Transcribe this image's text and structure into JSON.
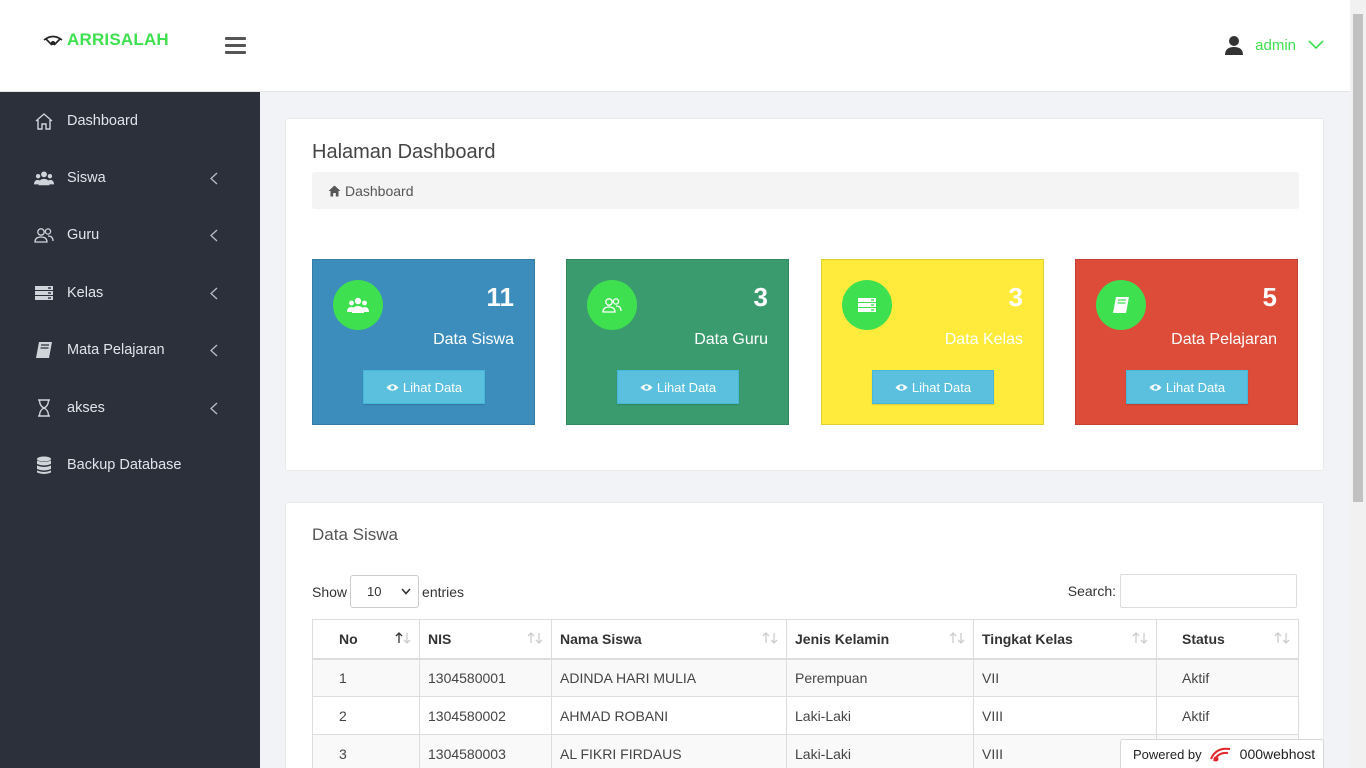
{
  "brand": {
    "name": "ARRISALAH"
  },
  "header": {
    "username": "admin"
  },
  "sidebar": {
    "items": [
      {
        "label": "Dashboard",
        "icon": "home-icon"
      },
      {
        "label": "Siswa",
        "icon": "users-icon"
      },
      {
        "label": "Guru",
        "icon": "user-group-icon"
      },
      {
        "label": "Kelas",
        "icon": "server-icon"
      },
      {
        "label": "Mata Pelajaran",
        "icon": "book-icon"
      },
      {
        "label": "akses",
        "icon": "hourglass-icon"
      },
      {
        "label": "Backup Database",
        "icon": "database-icon"
      }
    ]
  },
  "page": {
    "title": "Halaman Dashboard",
    "breadcrumb": "Dashboard"
  },
  "cards": [
    {
      "count": "11",
      "label": "Data Siswa",
      "button": "Lihat Data",
      "color": "#3c8dbc"
    },
    {
      "count": "3",
      "label": "Data Guru",
      "button": "Lihat Data",
      "color": "#3a9b6e"
    },
    {
      "count": "3",
      "label": "Data Kelas",
      "button": "Lihat Data",
      "color": "#ffeb3b"
    },
    {
      "count": "5",
      "label": "Data Pelajaran",
      "button": "Lihat Data",
      "color": "#dd4b39"
    }
  ],
  "students_section": {
    "title": "Data Siswa",
    "show_label": "Show",
    "entries_value": "10",
    "entries_label": "entries",
    "search_label": "Search:",
    "columns": [
      "No",
      "NIS",
      "Nama Siswa",
      "Jenis Kelamin",
      "Tingkat Kelas",
      "Status"
    ],
    "rows": [
      [
        "1",
        "1304580001",
        "ADINDA HARI MULIA",
        "Perempuan",
        "VII",
        "Aktif"
      ],
      [
        "2",
        "1304580002",
        "AHMAD ROBANI",
        "Laki-Laki",
        "VIII",
        "Aktif"
      ],
      [
        "3",
        "1304580003",
        "AL FIKRI FIRDAUS",
        "Laki-Laki",
        "VIII",
        ""
      ]
    ]
  },
  "footer_badge": {
    "prefix": "Powered by",
    "name": "000webhost"
  }
}
